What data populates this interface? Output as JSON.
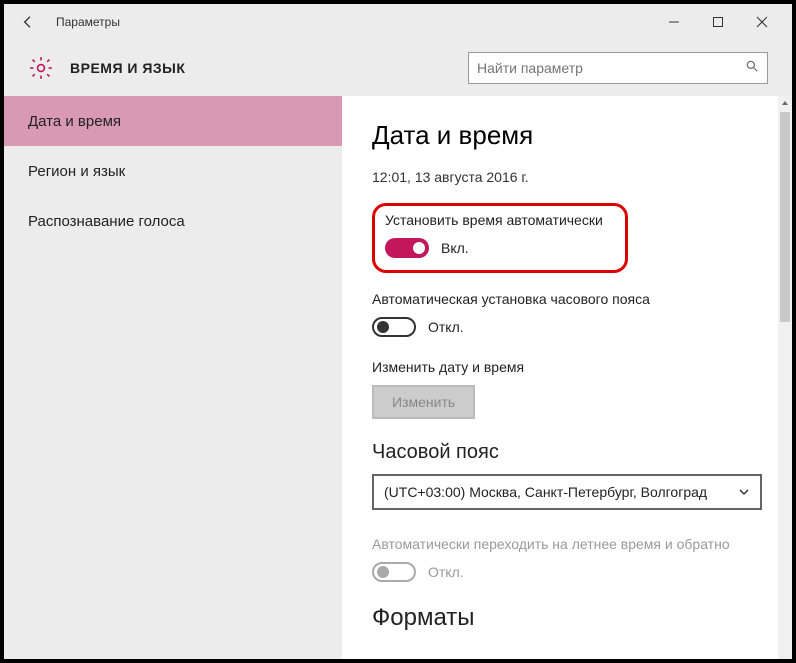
{
  "window": {
    "title": "Параметры"
  },
  "header": {
    "app_title": "ВРЕМЯ И ЯЗЫК",
    "search_placeholder": "Найти параметр"
  },
  "sidebar": {
    "items": [
      {
        "label": "Дата и время",
        "active": true
      },
      {
        "label": "Регион и язык",
        "active": false
      },
      {
        "label": "Распознавание голоса",
        "active": false
      }
    ]
  },
  "main": {
    "heading": "Дата и время",
    "current_datetime": "12:01, 13 августа 2016 г.",
    "auto_time": {
      "label": "Установить время автоматически",
      "state_text": "Вкл.",
      "on": true
    },
    "auto_tz": {
      "label": "Автоматическая установка часового пояса",
      "state_text": "Откл.",
      "on": false
    },
    "change": {
      "label": "Изменить дату и время",
      "button": "Изменить"
    },
    "timezone": {
      "label": "Часовой пояс",
      "value": "(UTC+03:00) Москва, Санкт-Петербург, Волгоград"
    },
    "dst": {
      "label": "Автоматически переходить на летнее время и обратно",
      "state_text": "Откл."
    },
    "formats_heading": "Форматы"
  }
}
